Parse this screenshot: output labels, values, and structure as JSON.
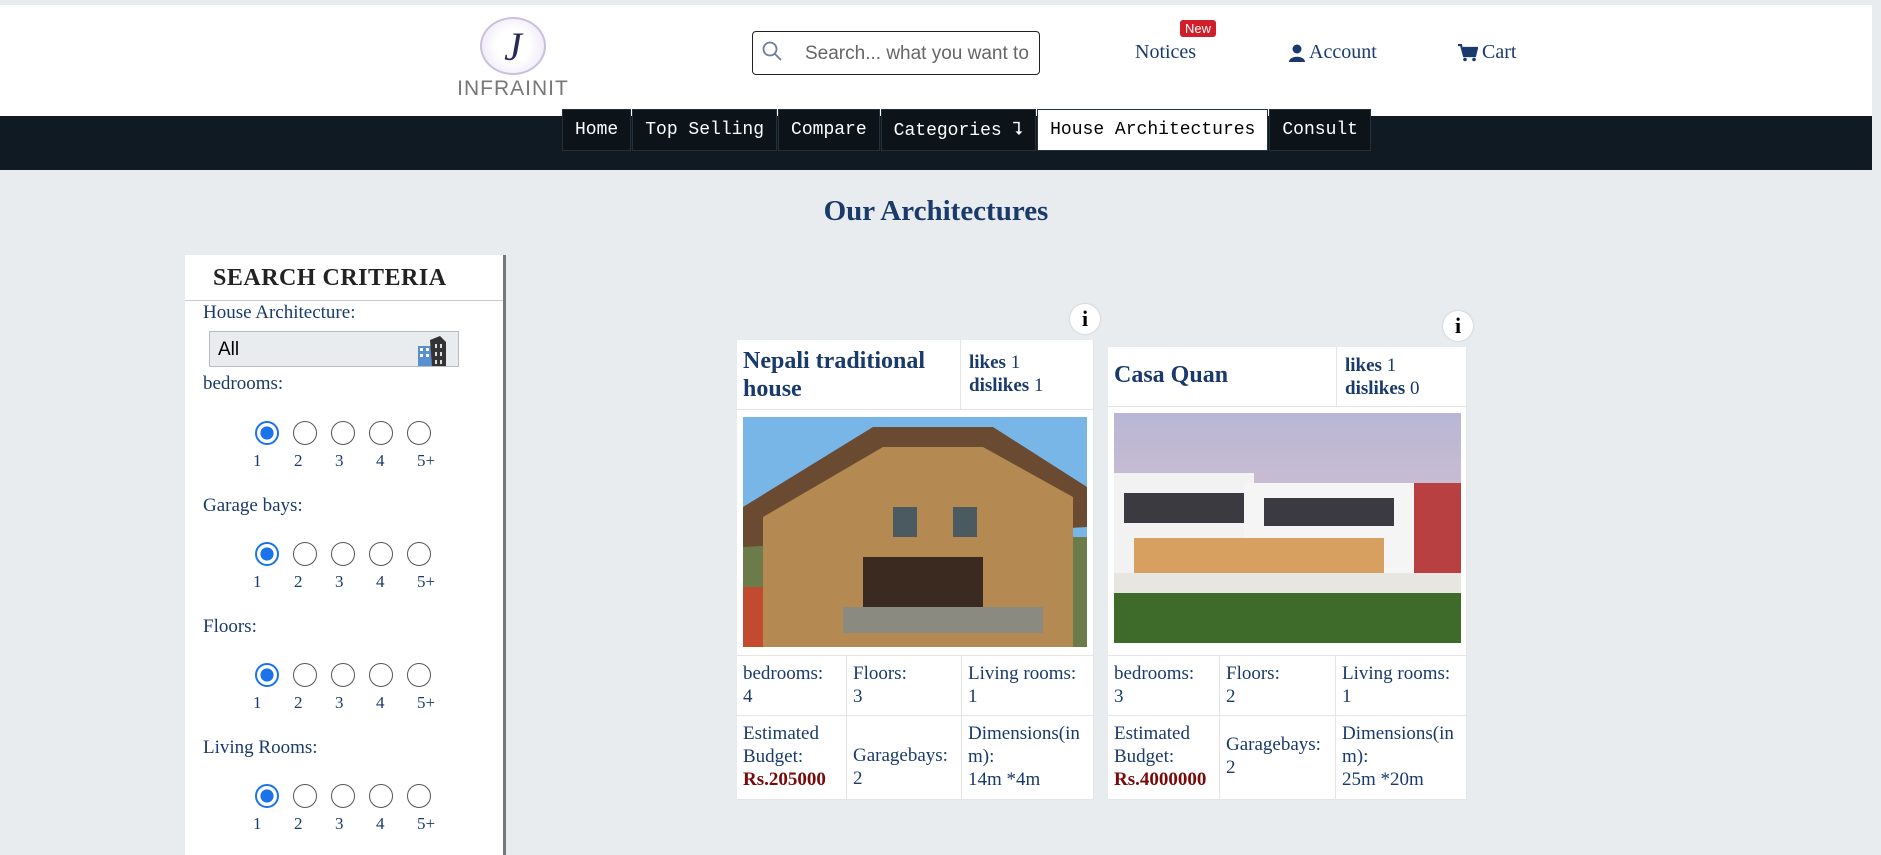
{
  "header": {
    "logo_text": "INFRAINIT",
    "logo_letter": "J",
    "search_placeholder": "Search... what you want to",
    "notices_label": "Notices",
    "new_badge": "New",
    "account_label": "Account",
    "cart_label": "Cart"
  },
  "nav": [
    {
      "label": "Home",
      "active": false
    },
    {
      "label": "Top Selling",
      "active": false
    },
    {
      "label": "Compare",
      "active": false
    },
    {
      "label": "Categories ⮧",
      "active": false
    },
    {
      "label": "House Architectures",
      "active": true
    },
    {
      "label": "Consult",
      "active": false
    }
  ],
  "page_title": "Our Architectures",
  "sidebar": {
    "title": "SEARCH CRITERIA",
    "architecture_label": "House Architecture:",
    "architecture_value": "All",
    "groups": [
      {
        "label": "bedrooms:",
        "options": [
          "1",
          "2",
          "3",
          "4",
          "5+"
        ],
        "selected": "1"
      },
      {
        "label": "Garage bays:",
        "options": [
          "1",
          "2",
          "3",
          "4",
          "5+"
        ],
        "selected": "1"
      },
      {
        "label": "Floors:",
        "options": [
          "1",
          "2",
          "3",
          "4",
          "5+"
        ],
        "selected": "1"
      },
      {
        "label": "Living Rooms:",
        "options": [
          "1",
          "2",
          "3",
          "4",
          "5+"
        ],
        "selected": "1"
      }
    ]
  },
  "cards": [
    {
      "name": "Nepali traditional house",
      "likes_label": "likes",
      "likes": "1",
      "dislikes_label": "dislikes",
      "dislikes": "1",
      "bedrooms_label": "bedrooms:",
      "bedrooms": "4",
      "floors_label": "Floors:",
      "floors": "3",
      "living_label": "Living rooms:",
      "living": "1",
      "budget_label": "Estimated Budget:",
      "budget": "Rs.205000",
      "garage_label": "Garagebays:",
      "garage": "2",
      "dimensions_label": "Dimensions(in m):",
      "dimensions": "14m *4m",
      "info_icon": "i"
    },
    {
      "name": "Casa Quan",
      "likes_label": "likes",
      "likes": "1",
      "dislikes_label": "dislikes",
      "dislikes": "0",
      "bedrooms_label": "bedrooms:",
      "bedrooms": "3",
      "floors_label": "Floors:",
      "floors": "2",
      "living_label": "Living rooms:",
      "living": "1",
      "budget_label": "Estimated Budget:",
      "budget": "Rs.4000000",
      "garage_label": "Garagebays:",
      "garage": "2",
      "dimensions_label": "Dimensions(in m):",
      "dimensions": "25m *20m",
      "info_icon": "i"
    }
  ],
  "colors": {
    "accent": "#1a3a6b",
    "navbar": "#0f1a22",
    "badge": "#d01f2a",
    "budget": "#7a0a0a",
    "radio": "#1a73e8"
  }
}
